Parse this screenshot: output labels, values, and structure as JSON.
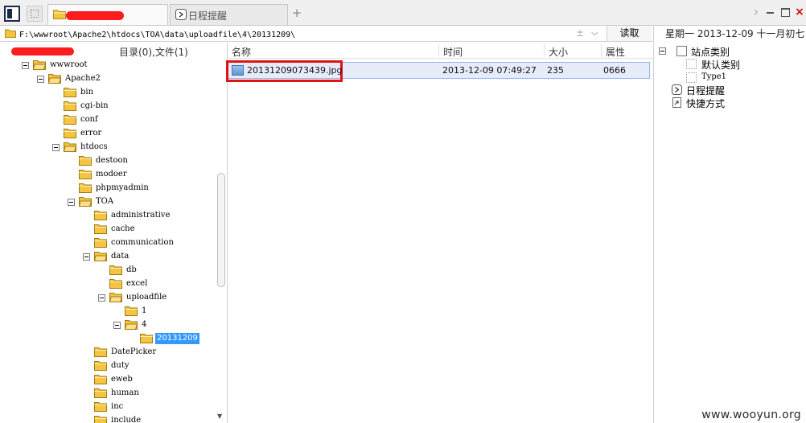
{
  "tabs": [
    {
      "label": "",
      "redacted": true,
      "active": true
    },
    {
      "label": "日程提醒",
      "active": false
    }
  ],
  "toolbar": {
    "add_tab": "+",
    "next": "›",
    "close": "×"
  },
  "address": {
    "path": "F:\\wwwroot\\Apache2\\htdocs\\TOA\\data\\uploadfile\\4\\20131209\\",
    "plus": "±",
    "dropdown": "⌵",
    "read_button": "读取"
  },
  "date": {
    "weekday": "星期一",
    "date": "2013-12-09",
    "lunar": "十一月初七"
  },
  "tree": {
    "summary": "目录(0),文件(1)",
    "nodes": [
      {
        "label": "wwwroot",
        "expanded": true,
        "selected": false
      },
      {
        "label": "Apache2",
        "expanded": true,
        "selected": false
      },
      {
        "label": "bin",
        "expanded": false,
        "selected": false
      },
      {
        "label": "cgi-bin",
        "expanded": false,
        "selected": false
      },
      {
        "label": "conf",
        "expanded": false,
        "selected": false
      },
      {
        "label": "error",
        "expanded": false,
        "selected": false
      },
      {
        "label": "htdocs",
        "expanded": true,
        "selected": false
      },
      {
        "label": "destoon",
        "expanded": false,
        "selected": false
      },
      {
        "label": "modoer",
        "expanded": false,
        "selected": false
      },
      {
        "label": "phpmyadmin",
        "expanded": false,
        "selected": false
      },
      {
        "label": "TOA",
        "expanded": true,
        "selected": false
      },
      {
        "label": "administrative",
        "expanded": false,
        "selected": false
      },
      {
        "label": "cache",
        "expanded": false,
        "selected": false
      },
      {
        "label": "communication",
        "expanded": false,
        "selected": false
      },
      {
        "label": "data",
        "expanded": true,
        "selected": false
      },
      {
        "label": "db",
        "expanded": false,
        "selected": false
      },
      {
        "label": "excel",
        "expanded": false,
        "selected": false
      },
      {
        "label": "uploadfile",
        "expanded": true,
        "selected": false
      },
      {
        "label": "1",
        "expanded": false,
        "selected": false
      },
      {
        "label": "4",
        "expanded": true,
        "selected": false
      },
      {
        "label": "20131209",
        "expanded": false,
        "selected": true
      },
      {
        "label": "DatePicker",
        "expanded": false,
        "selected": false
      },
      {
        "label": "duty",
        "expanded": false,
        "selected": false
      },
      {
        "label": "eweb",
        "expanded": false,
        "selected": false
      },
      {
        "label": "human",
        "expanded": false,
        "selected": false
      },
      {
        "label": "inc",
        "expanded": false,
        "selected": false
      },
      {
        "label": "include",
        "expanded": false,
        "selected": false
      }
    ]
  },
  "file_list": {
    "columns": [
      "名称",
      "时间",
      "大小",
      "属性"
    ],
    "rows": [
      {
        "name": "20131209073439.jpg",
        "time": "2013-12-09 07:49:27",
        "size": "235",
        "attr": "0666"
      }
    ]
  },
  "side": {
    "items": [
      {
        "label": "站点类别"
      },
      {
        "label": "默认类别"
      },
      {
        "label": "Type1"
      },
      {
        "label": "日程提醒"
      },
      {
        "label": "快捷方式"
      }
    ]
  },
  "watermark": "www.wooyun.org",
  "colors": {
    "selection": "#3399ff",
    "highlight": "#e01414",
    "redaction": "#ff1c1c",
    "row": "#e6ecfa",
    "folder": "#f5c542"
  }
}
